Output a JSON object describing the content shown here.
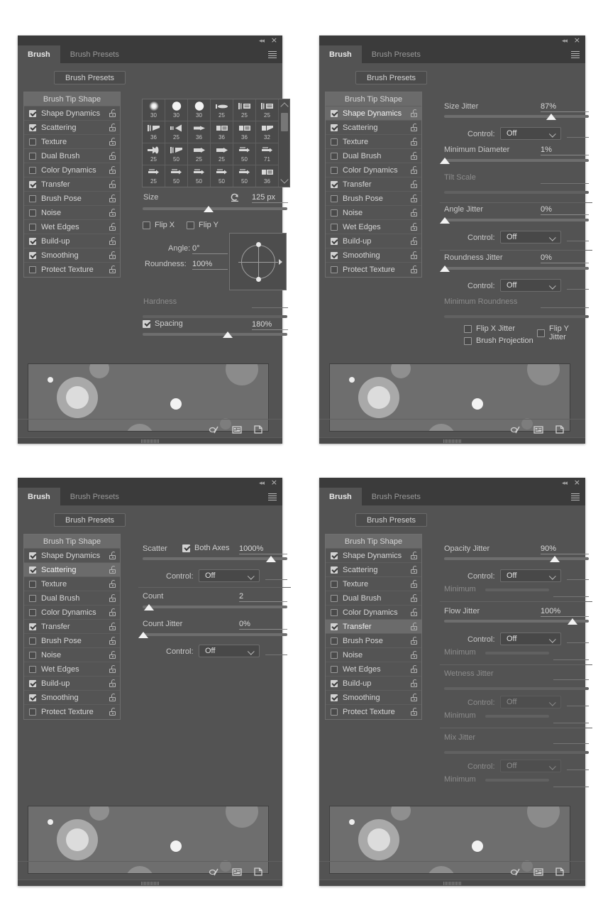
{
  "window": {
    "collapse_icon": "collapse-double-arrow",
    "close_icon": "×",
    "menu_icon": "panel-menu"
  },
  "tabs": {
    "brush": "Brush",
    "brush_presets": "Brush Presets"
  },
  "presets_button": "Brush Presets",
  "option_list": {
    "header": "Brush Tip Shape",
    "items": [
      {
        "label": "Shape Dynamics",
        "checked": true
      },
      {
        "label": "Scattering",
        "checked": true
      },
      {
        "label": "Texture",
        "checked": false
      },
      {
        "label": "Dual Brush",
        "checked": false
      },
      {
        "label": "Color Dynamics",
        "checked": false
      },
      {
        "label": "Transfer",
        "checked": true
      },
      {
        "label": "Brush Pose",
        "checked": false
      },
      {
        "label": "Noise",
        "checked": false
      },
      {
        "label": "Wet Edges",
        "checked": false
      },
      {
        "label": "Build-up",
        "checked": true
      },
      {
        "label": "Smoothing",
        "checked": true
      },
      {
        "label": "Protect Texture",
        "checked": false
      }
    ]
  },
  "panel1": {
    "selected_option": "Brush Tip Shape",
    "preset_grid": [
      {
        "size": "30",
        "tip": "soft-round"
      },
      {
        "size": "30",
        "tip": "hard-round"
      },
      {
        "size": "30",
        "tip": "hard-round"
      },
      {
        "size": "25",
        "tip": "flat-tip"
      },
      {
        "size": "25",
        "tip": "flat-blunt"
      },
      {
        "size": "25",
        "tip": "flat-blunt"
      },
      {
        "size": "36",
        "tip": "angle-flat"
      },
      {
        "size": "25",
        "tip": "fan-tip"
      },
      {
        "size": "36",
        "tip": "round-point"
      },
      {
        "size": "36",
        "tip": "flat-square"
      },
      {
        "size": "36",
        "tip": "flat-square"
      },
      {
        "size": "32",
        "tip": "angle-square"
      },
      {
        "size": "25",
        "tip": "wide-fan"
      },
      {
        "size": "50",
        "tip": "angle-flat"
      },
      {
        "size": "25",
        "tip": "flat-point"
      },
      {
        "size": "25",
        "tip": "flat-point"
      },
      {
        "size": "50",
        "tip": "pencil-tip"
      },
      {
        "size": "71",
        "tip": "pencil-tip"
      },
      {
        "size": "25",
        "tip": "pencil-tip"
      },
      {
        "size": "50",
        "tip": "pencil-tip"
      },
      {
        "size": "50",
        "tip": "pencil-tip"
      },
      {
        "size": "50",
        "tip": "pencil-tip"
      },
      {
        "size": "50",
        "tip": "pencil-tip"
      },
      {
        "size": "36",
        "tip": "flat-square"
      }
    ],
    "size": {
      "label": "Size",
      "value": "125 px",
      "slider_pct": 57,
      "reset_icon": "reset-arrow"
    },
    "flip_x": {
      "label": "Flip X",
      "checked": false
    },
    "flip_y": {
      "label": "Flip Y",
      "checked": false
    },
    "angle": {
      "label": "Angle:",
      "value": "0°"
    },
    "roundness": {
      "label": "Roundness:",
      "value": "100%"
    },
    "hardness": {
      "label": "Hardness",
      "value": "",
      "slider_pct": 0,
      "disabled": true
    },
    "spacing": {
      "label": "Spacing",
      "value": "180%",
      "checked": true,
      "slider_pct": 68
    }
  },
  "panel2": {
    "selected_option": "Shape Dynamics",
    "size_jitter": {
      "label": "Size Jitter",
      "value": "87%",
      "slider_pct": 86
    },
    "size_jitter_control": {
      "label": "Control:",
      "value": "Off"
    },
    "minimum_diameter": {
      "label": "Minimum Diameter",
      "value": "1%",
      "slider_pct": 1
    },
    "tilt_scale": {
      "label": "Tilt Scale",
      "value": "",
      "slider_pct": 0,
      "disabled": true
    },
    "angle_jitter": {
      "label": "Angle Jitter",
      "value": "0%",
      "slider_pct": 0
    },
    "angle_jitter_control": {
      "label": "Control:",
      "value": "Off"
    },
    "roundness_jitter": {
      "label": "Roundness Jitter",
      "value": "0%",
      "slider_pct": 0
    },
    "roundness_jitter_control": {
      "label": "Control:",
      "value": "Off"
    },
    "minimum_roundness": {
      "label": "Minimum Roundness",
      "value": "",
      "slider_pct": 0,
      "disabled": true
    },
    "flip_x_jitter": {
      "label": "Flip X Jitter",
      "checked": false
    },
    "flip_y_jitter": {
      "label": "Flip Y Jitter",
      "checked": false
    },
    "brush_projection": {
      "label": "Brush Projection",
      "checked": false
    }
  },
  "panel3": {
    "selected_option": "Scattering",
    "scatter": {
      "label": "Scatter",
      "value": "1000%",
      "slider_pct": 100
    },
    "both_axes": {
      "label": "Both Axes",
      "checked": true
    },
    "scatter_control": {
      "label": "Control:",
      "value": "Off"
    },
    "count": {
      "label": "Count",
      "value": "2",
      "slider_pct": 5
    },
    "count_jitter": {
      "label": "Count Jitter",
      "value": "0%",
      "slider_pct": 0
    },
    "count_jitter_control": {
      "label": "Control:",
      "value": "Off"
    }
  },
  "panel4": {
    "selected_option": "Transfer",
    "opacity_jitter": {
      "label": "Opacity Jitter",
      "value": "90%",
      "slider_pct": 89
    },
    "opacity_control": {
      "label": "Control:",
      "value": "Off"
    },
    "opacity_minimum": {
      "label": "Minimum",
      "value": "",
      "disabled": true
    },
    "flow_jitter": {
      "label": "Flow Jitter",
      "value": "100%",
      "slider_pct": 100
    },
    "flow_control": {
      "label": "Control:",
      "value": "Off"
    },
    "flow_minimum": {
      "label": "Minimum",
      "value": "",
      "disabled": true
    },
    "wetness_jitter": {
      "label": "Wetness Jitter",
      "value": "",
      "disabled": true
    },
    "wetness_control": {
      "label": "Control:",
      "value": "Off",
      "disabled": true
    },
    "wetness_minimum": {
      "label": "Minimum",
      "value": "",
      "disabled": true
    },
    "mix_jitter": {
      "label": "Mix Jitter",
      "value": "",
      "disabled": true
    },
    "mix_control": {
      "label": "Control:",
      "value": "Off",
      "disabled": true
    },
    "mix_minimum": {
      "label": "Minimum",
      "value": "",
      "disabled": true
    }
  },
  "footer_icons": {
    "toggle_live_tip": "live-brush-tip-icon",
    "new_preset": "brush-preset-icon",
    "new_brush": "new-brush-icon"
  },
  "colors": {
    "panel_bg": "#535353",
    "tabbar_bg": "#3b3b3b",
    "selected_row": "#6b6b6b",
    "text": "#d6d6d6",
    "text_dim": "#8c8c8c",
    "preview_bg": "#6e6e6e"
  }
}
